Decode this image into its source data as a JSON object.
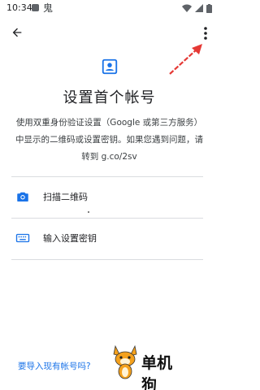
{
  "status_bar": {
    "time": "10:34",
    "app_glyph": "鬼"
  },
  "header": {
    "back_icon": "arrow-back-icon",
    "menu_icon": "more-vert-icon"
  },
  "main": {
    "hero_icon": "account-box-icon",
    "title": "设置首个帐号",
    "description_lines": [
      "使用双重身份验证设置（Google 或第三方服务）",
      "中显示的二维码或设置密钥。如果您遇到问题，请",
      "转到 g.co/2sv"
    ]
  },
  "options": [
    {
      "icon": "camera-icon",
      "label": "扫描二维码"
    },
    {
      "icon": "keyboard-icon",
      "label": "输入设置密钥"
    }
  ],
  "footer": {
    "import_link": "要导入现有帐号吗?"
  },
  "watermark": {
    "text": "单机狗"
  },
  "colors": {
    "accent": "#1a73e8",
    "annotation_arrow": "#e53935",
    "divider": "#dadce0",
    "text_primary": "#202124"
  }
}
